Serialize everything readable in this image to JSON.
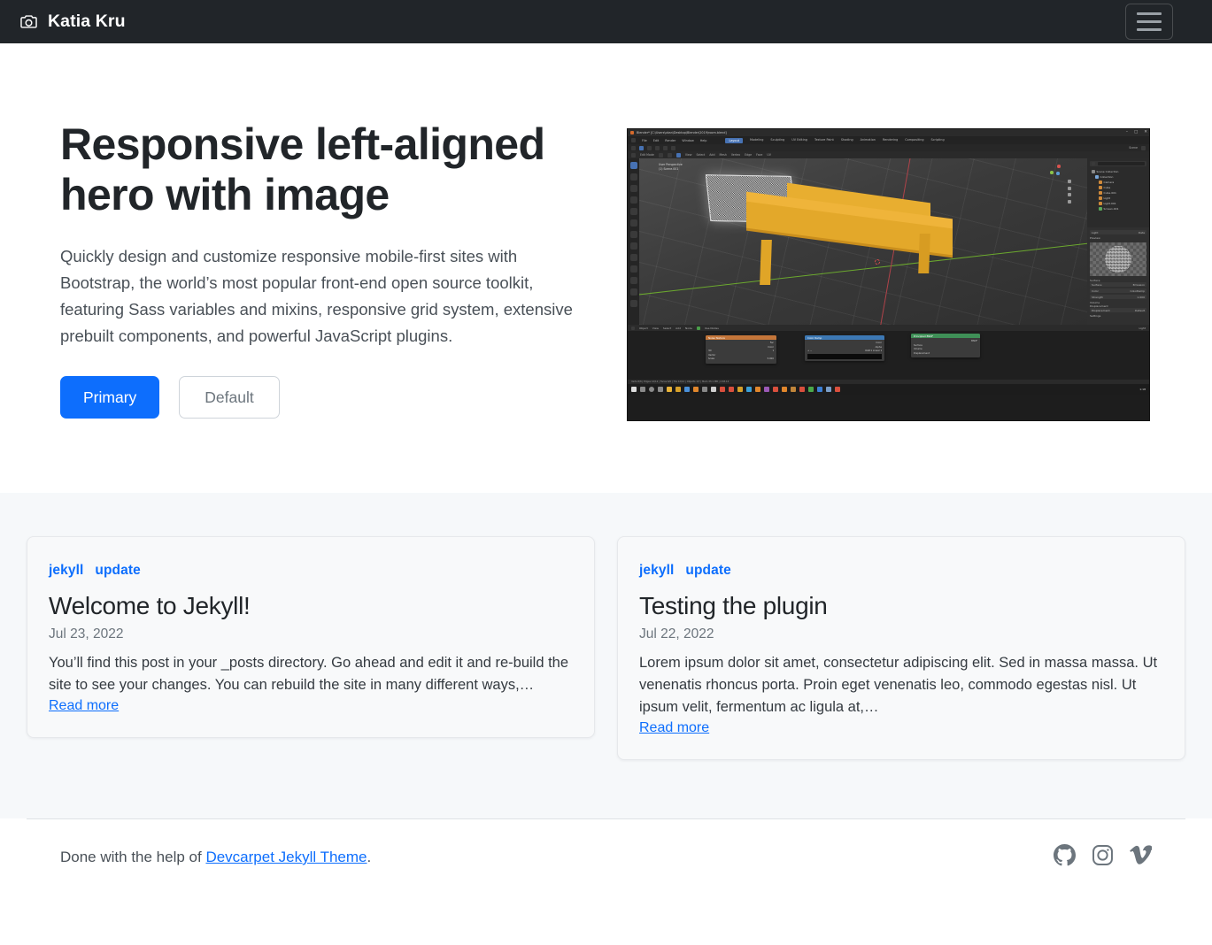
{
  "navbar": {
    "brand": "Katia Kru",
    "brand_icon": "camera-icon",
    "toggler_label": "Toggle navigation",
    "background": "#212529"
  },
  "hero": {
    "title": "Responsive left-aligned hero with image",
    "lead": "Quickly design and customize responsive mobile-first sites with Bootstrap, the world’s most popular front-end open source toolkit, featuring Sass variables and mixins, responsive grid system, extensive prebuilt components, and powerful JavaScript plugins.",
    "buttons": {
      "primary": "Primary",
      "default": "Default"
    },
    "image": {
      "alt": "Blender 3D modeling screenshot of an orange table",
      "window_title": "Blender* [C:\\Users\\okan\\Desktop\\Blender\\2019\\room.blend]",
      "menu": [
        "File",
        "Edit",
        "Render",
        "Window",
        "Help"
      ],
      "tabs": [
        "Layout",
        "Modeling",
        "Sculpting",
        "UV Editing",
        "Texture Paint",
        "Shading",
        "Animation",
        "Rendering",
        "Compositing",
        "Scripting"
      ],
      "active_tab": "Layout",
      "mode": "Edit Mode",
      "viewport_overlay": [
        "User Perspective",
        "(1) Scene.001"
      ],
      "outliner": [
        "Scene Collection",
        "Collection",
        "Camera",
        "Cube",
        "Cube.001",
        "Light",
        "Light.001",
        "Screen.001"
      ],
      "shader_nodes": [
        "Noise Texture",
        "Color Ramp",
        "Principled BSDF"
      ],
      "properties": [
        "Preview",
        "Surface",
        "Volume",
        "Displacement",
        "Settings"
      ],
      "property_values": [
        {
          "label": "Surface",
          "value": "Emission"
        },
        {
          "label": "Color",
          "value": "ColorRamp"
        },
        {
          "label": "Strength",
          "value": "1.000"
        },
        {
          "label": "Displacement",
          "value": "Default"
        }
      ],
      "statusbar": "Verts 8/8 | Edges 12/12 | Faces 6/6 | Tris 12/12 | Objects 1/7 | Mem 33.1 MB | 2.83.12",
      "clock": "1:18"
    }
  },
  "posts": [
    {
      "tags": [
        "jekyll",
        "update"
      ],
      "title": "Welcome to Jekyll!",
      "date": "Jul 23, 2022",
      "excerpt": "You’ll find this post in your _posts directory. Go ahead and edit it and re-build the site to see your changes. You can rebuild the site in many different ways,…",
      "read_more": "Read more"
    },
    {
      "tags": [
        "jekyll",
        "update"
      ],
      "title": "Testing the plugin",
      "date": "Jul 22, 2022",
      "excerpt": "Lorem ipsum dolor sit amet, consectetur adipiscing elit. Sed in massa massa. Ut venenatis rhoncus porta. Proin eget venenatis leo, commodo egestas nisl. Ut ipsum velit, fermentum ac ligula at,…",
      "read_more": "Read more"
    }
  ],
  "footer": {
    "text_before": "Done with the help of ",
    "link_text": "Devcarpet Jekyll Theme",
    "text_after": ".",
    "socials": [
      {
        "name": "github-icon",
        "label": "GitHub"
      },
      {
        "name": "instagram-icon",
        "label": "Instagram"
      },
      {
        "name": "vimeo-icon",
        "label": "Vimeo"
      }
    ]
  },
  "colors": {
    "navbar_bg": "#212529",
    "primary": "#0d6efd",
    "section_bg": "#f6f8fa",
    "muted": "#6c757d"
  }
}
